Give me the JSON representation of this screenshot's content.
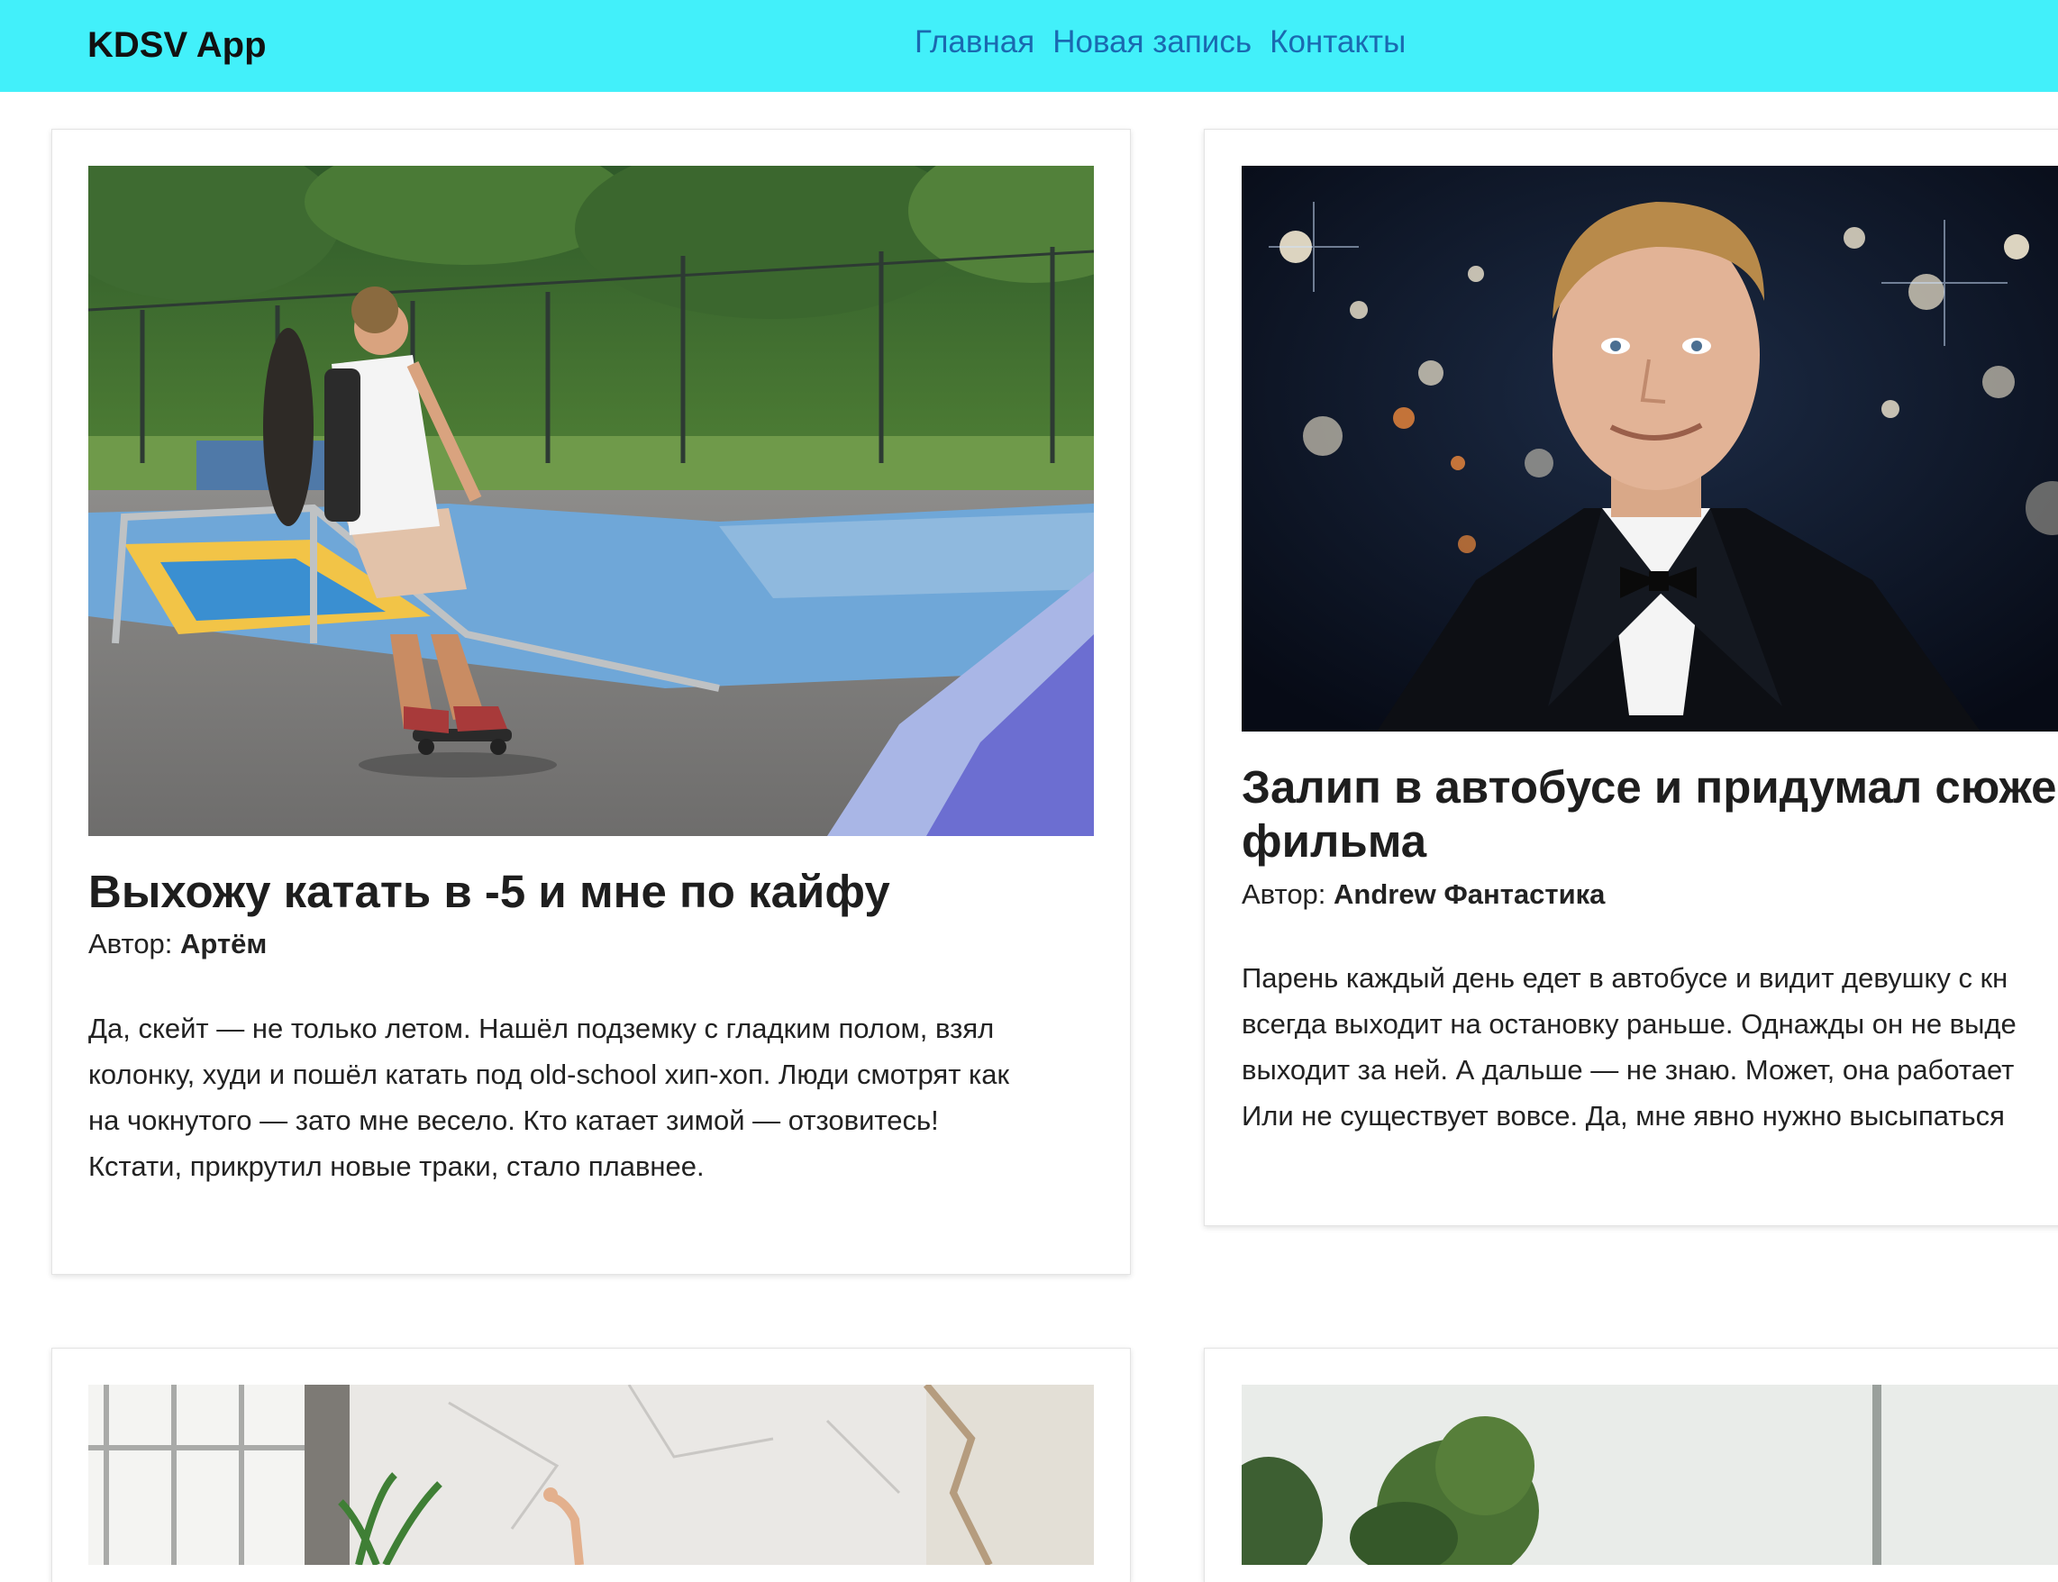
{
  "navbar": {
    "brand": "KDSV App",
    "links": [
      "Главная",
      "Новая запись",
      "Контакты"
    ],
    "background": "#42f0fa",
    "link_color": "#1a69b0"
  },
  "posts": [
    {
      "title": "Выхожу катать в -5 и мне по кайфу",
      "author_label": "Автор:",
      "author": "Артём",
      "text_lines": [
        "Да, скейт — не только летом. Нашёл подземку с гладким полом, взял",
        "колонку, худи и пошёл катать под old-school хип-хоп. Люди смотрят как",
        "на чокнутого — зато мне весело. Кто катает зимой — отзовитесь!",
        "Кстати, прикрутил новые траки, стало плавнее."
      ]
    },
    {
      "title_lines": [
        "Залип в автобусе и придумал сюже",
        "фильма"
      ],
      "author_label": "Автор:",
      "author": "Andrew Фантастика",
      "text_lines": [
        "Парень каждый день едет в автобусе и видит девушку с кн",
        "всегда выходит на остановку раньше. Однажды он не выде",
        "выходит за ней. А дальше — не знаю. Может, она работает",
        "Или не существует вовсе. Да, мне явно нужно высыпаться"
      ]
    }
  ]
}
